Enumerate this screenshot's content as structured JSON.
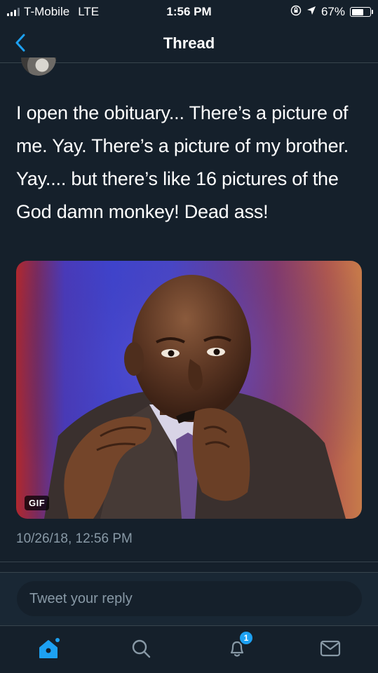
{
  "status_bar": {
    "carrier": "T-Mobile",
    "network": "LTE",
    "time": "1:56 PM",
    "battery": "67%",
    "battery_level": 0.67,
    "icons": [
      "signal-icon",
      "orientation-lock-icon",
      "location-arrow-icon",
      "battery-icon"
    ]
  },
  "nav": {
    "title": "Thread",
    "back_icon": "chevron-left-icon"
  },
  "tweet": {
    "text": "I open the obituary... There’s a picture of me. Yay. There’s a picture of my brother. Yay.... but there’s like 16 pictures of the God damn monkey! Dead ass!",
    "media_badge": "GIF",
    "timestamp": "10/26/18, 12:56 PM"
  },
  "reply": {
    "placeholder": "Tweet your reply"
  },
  "tab_bar": {
    "items": [
      "home-icon",
      "search-icon",
      "notifications-icon",
      "messages-icon"
    ],
    "notification_count": "1"
  },
  "colors": {
    "background": "#15202b",
    "accent": "#1da1f2",
    "secondary_text": "#8899a6",
    "divider": "#38444d"
  }
}
